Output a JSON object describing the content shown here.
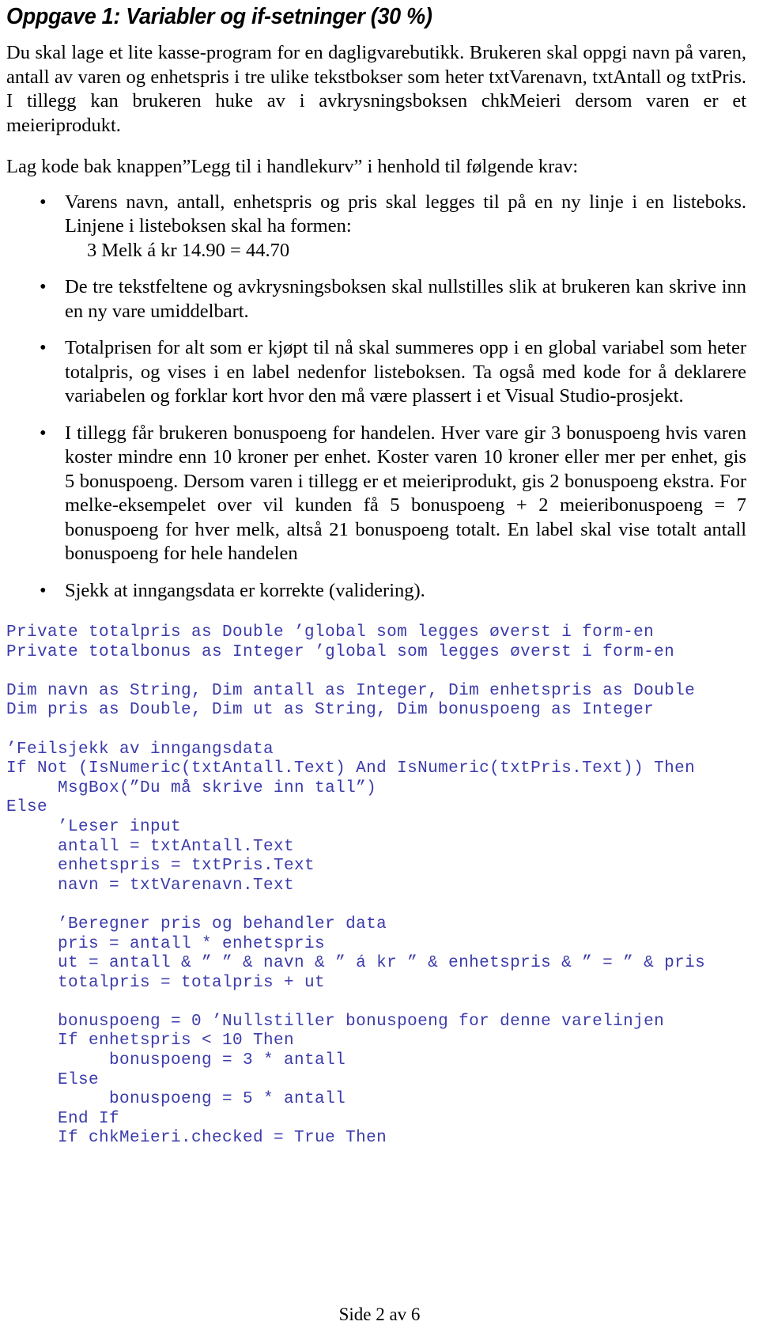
{
  "document": {
    "title": "Oppgave 1: Variabler og if-setninger (30 %)",
    "intro_paragraph": "Du skal lage et lite kasse-program for en dagligvarebutikk. Brukeren skal oppgi navn på varen, antall av varen og enhetspris i tre ulike tekstbokser som heter txtVarenavn, txtAntall og txtPris. I tillegg kan brukeren huke av i avkrysningsboksen chkMeieri dersom varen er et meieriprodukt.",
    "lead_paragraph": "Lag kode bak knappen”Legg til i handlekurv” i henhold til følgende krav:",
    "bullet_marker": "•",
    "bullets": [
      {
        "text": "Varens navn, antall, enhetspris og pris skal legges til på en ny linje i en listeboks. Linjene i listeboksen skal ha formen:",
        "sub": "3 Melk á kr 14.90 = 44.70"
      },
      {
        "text": "De tre tekstfeltene og avkrysningsboksen skal nullstilles slik at brukeren kan skrive inn en ny vare umiddelbart.",
        "sub": ""
      },
      {
        "text": "Totalprisen for alt som er kjøpt til nå skal summeres opp i en global variabel som heter totalpris, og vises i en label nedenfor listeboksen. Ta også med kode for å deklarere variabelen og forklar kort hvor den må være plassert i et Visual Studio-prosjekt.",
        "sub": ""
      },
      {
        "text": "I tillegg får brukeren bonuspoeng for handelen. Hver vare gir 3 bonuspoeng hvis varen koster mindre enn 10 kroner per enhet. Koster varen 10 kroner eller mer per enhet, gis 5 bonuspoeng. Dersom varen i tillegg er et meieriprodukt, gis 2 bonuspoeng ekstra. For melke-eksempelet over vil kunden få 5 bonuspoeng + 2 meieribonuspoeng = 7 bonuspoeng for hver melk, altså 21 bonuspoeng totalt. En label skal vise totalt antall bonuspoeng for hele handelen",
        "sub": ""
      },
      {
        "text": "Sjekk at inngangsdata er korrekte (validering).",
        "sub": ""
      }
    ],
    "code_color": "#3b3bab",
    "code_lines": [
      "Private totalpris as Double ’global som legges øverst i form-en",
      "Private totalbonus as Integer ’global som legges øverst i form-en",
      "",
      "Dim navn as String, Dim antall as Integer, Dim enhetspris as Double",
      "Dim pris as Double, Dim ut as String, Dim bonuspoeng as Integer",
      "",
      "’Feilsjekk av inngangsdata",
      "If Not (IsNumeric(txtAntall.Text) And IsNumeric(txtPris.Text)) Then",
      "     MsgBox(”Du må skrive inn tall”)",
      "Else",
      "     ’Leser input",
      "     antall = txtAntall.Text",
      "     enhetspris = txtPris.Text",
      "     navn = txtVarenavn.Text",
      "",
      "     ’Beregner pris og behandler data",
      "     pris = antall * enhetspris",
      "     ut = antall & ” ” & navn & ” á kr ” & enhetspris & ” = ” & pris",
      "     totalpris = totalpris + ut",
      "",
      "     bonuspoeng = 0 ’Nullstiller bonuspoeng for denne varelinjen",
      "     If enhetspris < 10 Then",
      "          bonuspoeng = 3 * antall",
      "     Else",
      "          bonuspoeng = 5 * antall",
      "     End If",
      "     If chkMeieri.checked = True Then"
    ],
    "footer": "Side 2 av 6"
  }
}
